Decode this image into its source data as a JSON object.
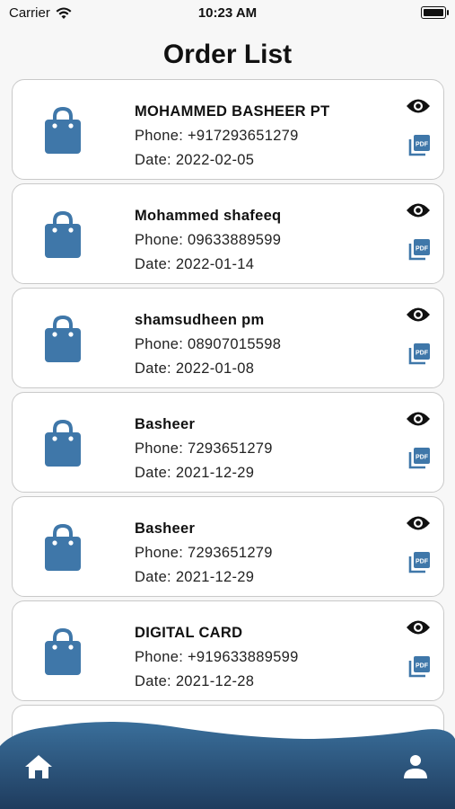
{
  "status": {
    "carrier": "Carrier",
    "time": "10:23 AM"
  },
  "title": "Order List",
  "orders": [
    {
      "name": "MOHAMMED BASHEER PT",
      "phone": "Phone: +917293651279",
      "date": "Date: 2022-02-05"
    },
    {
      "name": "Mohammed shafeeq",
      "phone": "Phone: 09633889599",
      "date": "Date: 2022-01-14"
    },
    {
      "name": "shamsudheen pm",
      "phone": "Phone: 08907015598",
      "date": "Date: 2022-01-08"
    },
    {
      "name": "Basheer",
      "phone": "Phone: 7293651279",
      "date": "Date: 2021-12-29"
    },
    {
      "name": "Basheer",
      "phone": "Phone: 7293651279",
      "date": "Date: 2021-12-29"
    },
    {
      "name": "DIGITAL CARD",
      "phone": "Phone: +919633889599",
      "date": "Date: 2021-12-28"
    }
  ],
  "icons": {
    "order": "shopping-bag-icon",
    "view": "eye-icon",
    "pdf": "pdf-icon",
    "home": "home-icon",
    "profile": "person-icon"
  },
  "colors": {
    "accent": "#3f77a9",
    "nav_top": "#3a6f9b",
    "nav_bottom": "#1f3c5e"
  }
}
